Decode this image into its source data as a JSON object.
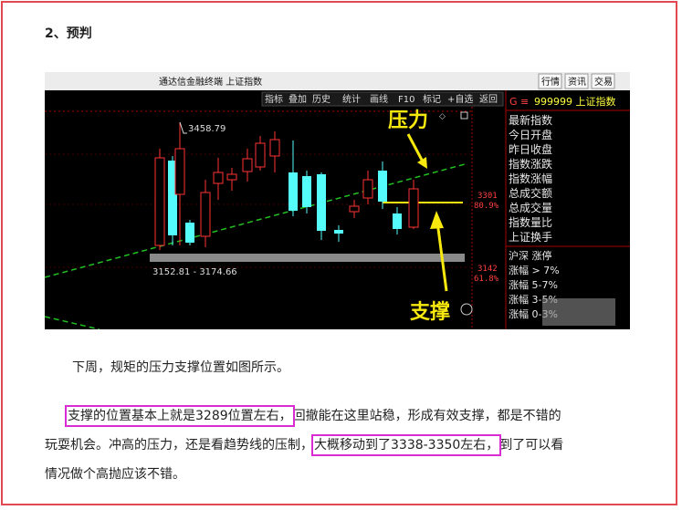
{
  "doc": {
    "heading": "2、预判",
    "para1": "下周，规矩的压力支撑位置如图所示。",
    "para2": {
      "hl1": "支撑的位置基本上就是3289位置左右，",
      "mid1": "回撤能在这里站稳，形成有效支撑，都是不错的",
      "line2_start": "玩耍机会。冲高的压力，还是看趋势线的压制，",
      "hl2": "大概移动到了3338-3350左右，",
      "line2_end": "到了可以看",
      "line3": "情况做个高抛应该不错。"
    }
  },
  "chart": {
    "window_title": "通达信金融终端 上证指数",
    "top_buttons": [
      "行情",
      "资讯",
      "交易"
    ],
    "toolbar": [
      "指标",
      "叠加",
      "历史",
      "统计",
      "画线",
      "F10",
      "标记",
      "+自选",
      "返回"
    ],
    "code_title": "999999 上证指数",
    "side_menu": [
      "最新指数",
      "今日开盘",
      "昨日收盘",
      "指数涨跌",
      "指数涨幅",
      "总成交额",
      "总成交量",
      "指数量比",
      "上证换手"
    ],
    "side_stats": [
      "沪深 涨停",
      "涨幅 > 7%",
      "涨幅 5-7%",
      "涨幅 3-5%",
      "涨幅 0-3%"
    ],
    "high_label": "3458.79",
    "range_label": "3152.81 - 3174.66",
    "level1": {
      "price": "3301",
      "pct": "80.9%"
    },
    "level2": {
      "price": "3142",
      "pct": "61.8%"
    },
    "pressure_label": "压力",
    "support_label": "支撑",
    "colors": {
      "up": "#ff3232",
      "down": "#54fcfc",
      "annot": "#f7e90e",
      "trend": "#21c121"
    }
  }
}
